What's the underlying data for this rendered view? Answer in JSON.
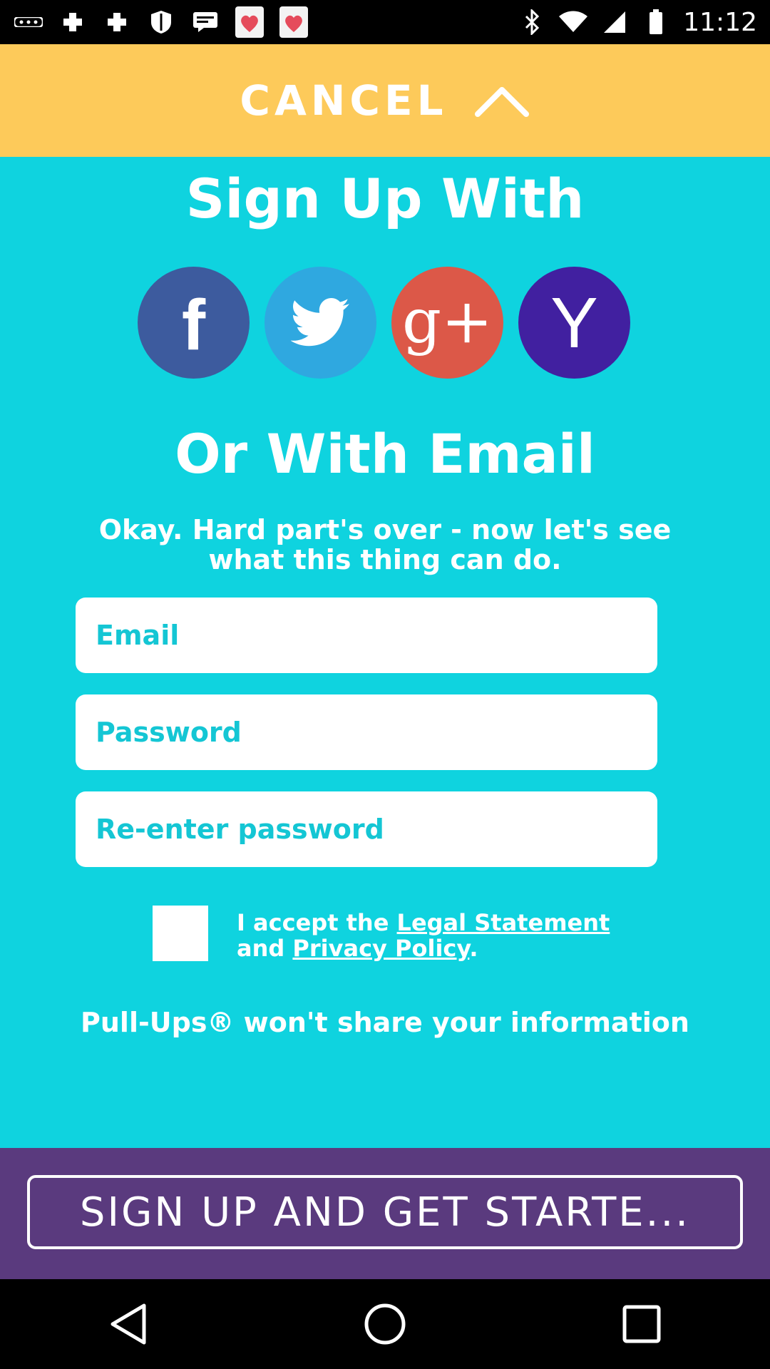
{
  "status_bar": {
    "time": "11:12",
    "left_icons": [
      "more-icon",
      "fast-meet-icon",
      "notification-icon",
      "shield-icon",
      "message-icon",
      "fast-meet-app-icon",
      "fast-meet-app-icon"
    ],
    "right_icons": [
      "bluetooth-icon",
      "wifi-icon",
      "signal-icon",
      "battery-icon"
    ]
  },
  "cancel_bar": {
    "label": "CANCEL"
  },
  "signup": {
    "title": "Sign Up With",
    "social": [
      {
        "name": "facebook",
        "glyph": "f",
        "color": "#3d5b9e"
      },
      {
        "name": "twitter",
        "color": "#2fa8e0"
      },
      {
        "name": "google-plus",
        "glyph": "g+",
        "color": "#dc5848"
      },
      {
        "name": "yahoo",
        "glyph": "Y",
        "color": "#4120a0"
      }
    ]
  },
  "email_section": {
    "title": "Or With Email",
    "subtitle": "Okay. Hard part's over - now let's see what this thing can do."
  },
  "form": {
    "email_placeholder": "Email",
    "password_placeholder": "Password",
    "reenter_placeholder": "Re-enter password"
  },
  "terms": {
    "prefix": "I accept the ",
    "legal_link": "Legal Statement",
    "middle": "and ",
    "privacy_link": "Privacy Policy",
    "suffix": "."
  },
  "share_note": "Pull-Ups® won't share your information",
  "cta": {
    "label": "SIGN UP AND GET STARTE..."
  },
  "colors": {
    "background": "#0fd3df",
    "cancel_bar": "#fdca5a",
    "bottom_bar": "#5a3a7e"
  }
}
